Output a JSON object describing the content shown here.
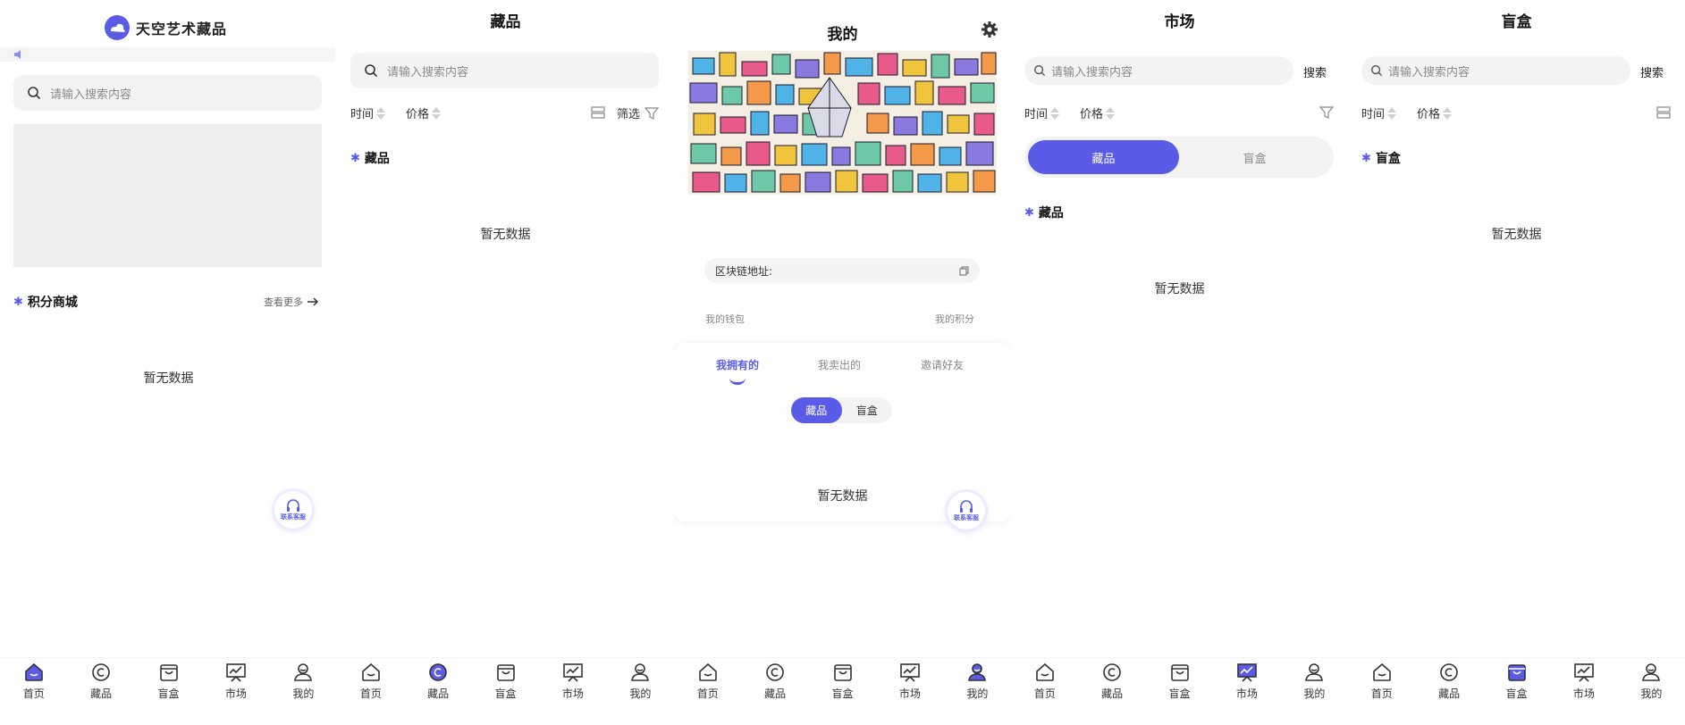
{
  "colors": {
    "accent": "#5a5ce8",
    "icon": "#333333"
  },
  "tabbar": {
    "tabs": [
      {
        "label": "首页",
        "icon": "home-icon"
      },
      {
        "label": "藏品",
        "icon": "copyright-icon"
      },
      {
        "label": "盲盒",
        "icon": "bag-icon"
      },
      {
        "label": "市场",
        "icon": "chart-icon"
      },
      {
        "label": "我的",
        "icon": "user-icon"
      }
    ]
  },
  "common": {
    "search_placeholder": "请输入搜索内容",
    "search_button": "搜索",
    "sort_time": "时间",
    "sort_price": "价格",
    "filter_label": "筛选",
    "empty_text": "暂无数据",
    "customer_service": "联系客服"
  },
  "home": {
    "brand_name": "天空艺术藏品",
    "section_title": "积分商城",
    "more_label": "查看更多"
  },
  "collection": {
    "title": "藏品",
    "section_title": "藏品"
  },
  "mine": {
    "title": "我的",
    "chain_address_label": "区块链地址:",
    "wallet_label": "我的钱包",
    "points_label": "我的积分",
    "tabs": [
      "我拥有的",
      "我卖出的",
      "邀请好友"
    ],
    "segment": [
      "藏品",
      "盲盒"
    ]
  },
  "market": {
    "title": "市场",
    "segment": [
      "藏品",
      "盲盒"
    ],
    "section_title": "藏品"
  },
  "blindbox": {
    "title": "盲盒",
    "section_title": "盲盒"
  }
}
